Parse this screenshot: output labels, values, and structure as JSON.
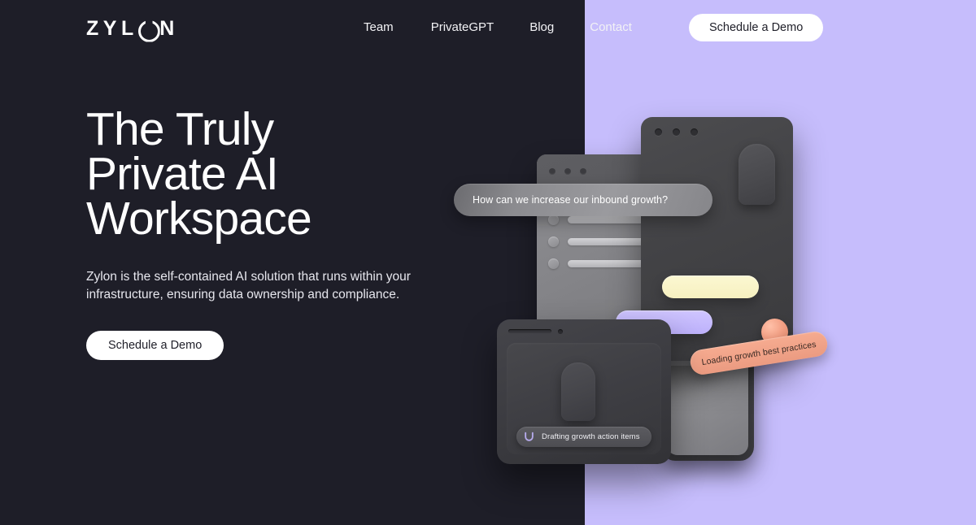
{
  "brand": {
    "logo_text_before": "ZYL",
    "logo_text_after": "N",
    "logo_full": "ZYLON",
    "logo_icon": "open-circle-o"
  },
  "colors": {
    "background_dark": "#1E1E28",
    "panel_purple": "#C6BDFC",
    "button_white": "#FFFFFF",
    "text_white": "#FFFFFF",
    "accent_peach": "#F0A085",
    "accent_cream": "#F8F2C6",
    "accent_purple": "#C3B8FD",
    "spinner_purple": "#B7ACEE"
  },
  "nav": {
    "links": [
      {
        "label": "Team"
      },
      {
        "label": "PrivateGPT"
      },
      {
        "label": "Blog"
      },
      {
        "label": "Contact"
      }
    ],
    "cta_label": "Schedule a Demo"
  },
  "hero": {
    "title": "The Truly\nPrivate AI\nWorkspace",
    "subtitle": "Zylon is the self-contained AI solution that runs within your infrastructure, ensuring data ownership and compliance.",
    "cta_label": "Schedule a Demo"
  },
  "illustration": {
    "chat_bubble": {
      "text": "How can we increase our inbound growth?"
    },
    "peach_pill": {
      "text": "Loading growth best practices"
    },
    "status_bar": {
      "text": "Drafting growth action items",
      "icon": "loading-spinner-icon"
    },
    "list_rows": [
      {
        "id": "row-1"
      },
      {
        "id": "row-2"
      },
      {
        "id": "row-3"
      }
    ],
    "window_dots": [
      {
        "id": "dot-1"
      },
      {
        "id": "dot-2"
      },
      {
        "id": "dot-3"
      }
    ]
  }
}
